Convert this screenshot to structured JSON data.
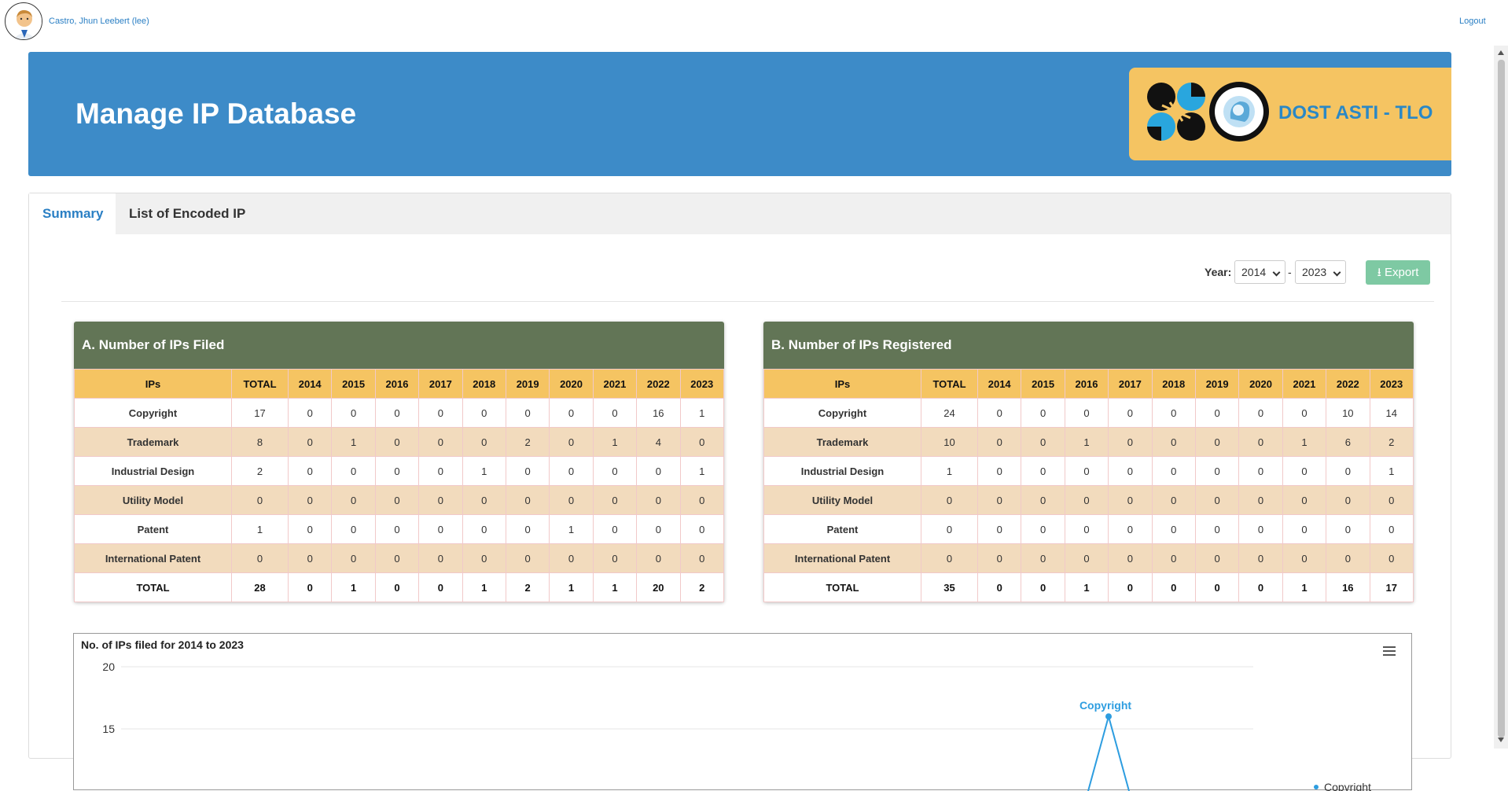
{
  "header": {
    "user_name": "Castro, Jhun Leebert (lee)",
    "logout_label": "Logout"
  },
  "banner": {
    "title": "Manage IP Database",
    "org_name": "DOST ASTI - TLO"
  },
  "tabs": [
    {
      "label": "Summary",
      "active": true
    },
    {
      "label": "List of Encoded IP",
      "active": false
    }
  ],
  "filters": {
    "year_label": "Year:",
    "from_year": "2014",
    "separator": "-",
    "to_year": "2023",
    "export_label": "Export"
  },
  "table_headers": [
    "IPs",
    "TOTAL",
    "2014",
    "2015",
    "2016",
    "2017",
    "2018",
    "2019",
    "2020",
    "2021",
    "2022",
    "2023"
  ],
  "filed": {
    "title": "A. Number of IPs Filed",
    "rows": [
      [
        "Copyright",
        "17",
        "0",
        "0",
        "0",
        "0",
        "0",
        "0",
        "0",
        "0",
        "16",
        "1"
      ],
      [
        "Trademark",
        "8",
        "0",
        "1",
        "0",
        "0",
        "0",
        "2",
        "0",
        "1",
        "4",
        "0"
      ],
      [
        "Industrial Design",
        "2",
        "0",
        "0",
        "0",
        "0",
        "1",
        "0",
        "0",
        "0",
        "0",
        "1"
      ],
      [
        "Utility Model",
        "0",
        "0",
        "0",
        "0",
        "0",
        "0",
        "0",
        "0",
        "0",
        "0",
        "0"
      ],
      [
        "Patent",
        "1",
        "0",
        "0",
        "0",
        "0",
        "0",
        "0",
        "1",
        "0",
        "0",
        "0"
      ],
      [
        "International Patent",
        "0",
        "0",
        "0",
        "0",
        "0",
        "0",
        "0",
        "0",
        "0",
        "0",
        "0"
      ],
      [
        "TOTAL",
        "28",
        "0",
        "1",
        "0",
        "0",
        "1",
        "2",
        "1",
        "1",
        "20",
        "2"
      ]
    ]
  },
  "registered": {
    "title": "B. Number of IPs Registered",
    "rows": [
      [
        "Copyright",
        "24",
        "0",
        "0",
        "0",
        "0",
        "0",
        "0",
        "0",
        "0",
        "10",
        "14"
      ],
      [
        "Trademark",
        "10",
        "0",
        "0",
        "1",
        "0",
        "0",
        "0",
        "0",
        "1",
        "6",
        "2"
      ],
      [
        "Industrial Design",
        "1",
        "0",
        "0",
        "0",
        "0",
        "0",
        "0",
        "0",
        "0",
        "0",
        "1"
      ],
      [
        "Utility Model",
        "0",
        "0",
        "0",
        "0",
        "0",
        "0",
        "0",
        "0",
        "0",
        "0",
        "0"
      ],
      [
        "Patent",
        "0",
        "0",
        "0",
        "0",
        "0",
        "0",
        "0",
        "0",
        "0",
        "0",
        "0"
      ],
      [
        "International Patent",
        "0",
        "0",
        "0",
        "0",
        "0",
        "0",
        "0",
        "0",
        "0",
        "0",
        "0"
      ],
      [
        "TOTAL",
        "35",
        "0",
        "0",
        "1",
        "0",
        "0",
        "0",
        "0",
        "1",
        "16",
        "17"
      ]
    ]
  },
  "chart_data": {
    "type": "line",
    "title": "No. of IPs filed for 2014 to 2023",
    "y_ticks": [
      "20",
      "15"
    ],
    "ylim": [
      0,
      20
    ],
    "grid": true,
    "visible_series_label": "Copyright",
    "legend_label": "Copyright",
    "color": "#2d9de0"
  }
}
